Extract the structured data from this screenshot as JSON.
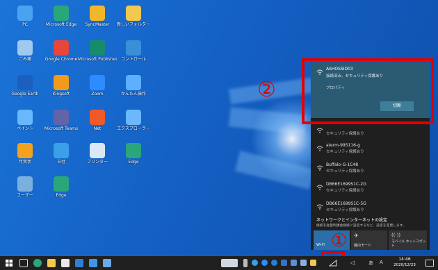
{
  "desktop_icons": [
    {
      "label": "PC",
      "icon": "pc-icon",
      "color": "#4aa3f0"
    },
    {
      "label": "Microsoft Edge",
      "icon": "edge-icon",
      "color": "#2aa77a"
    },
    {
      "label": "SyncMaster",
      "icon": "app-icon",
      "color": "#f1b72c"
    },
    {
      "label": "新しいフォルダー",
      "icon": "folder-icon",
      "color": "#f3c851"
    },
    {
      "label": "ごみ箱",
      "icon": "recycle-bin-icon",
      "color": "#9fc9ee"
    },
    {
      "label": "Google Chrome",
      "icon": "chrome-icon",
      "color": "#e9453a"
    },
    {
      "label": "Microsoft Publisher",
      "icon": "publisher-icon",
      "color": "#178c6a"
    },
    {
      "label": "コントロール",
      "icon": "control-panel-icon",
      "color": "#3a8fd8"
    },
    {
      "label": "Google Earth",
      "icon": "earth-icon",
      "color": "#1d5fbf"
    },
    {
      "label": "Kingsoft",
      "icon": "kingsoft-icon",
      "color": "#f39a1d"
    },
    {
      "label": "Zoom",
      "icon": "zoom-icon",
      "color": "#2d8cff"
    },
    {
      "label": "かんたん操作",
      "icon": "ease-icon",
      "color": "#5cb0ff"
    },
    {
      "label": "ペイント",
      "icon": "paint-icon",
      "color": "#68b7ff"
    },
    {
      "label": "Microsoft Teams",
      "icon": "teams-icon",
      "color": "#6264a7"
    },
    {
      "label": "Net",
      "icon": "net-icon",
      "color": "#f05a28"
    },
    {
      "label": "エクスプローラー",
      "icon": "explorer-icon",
      "color": "#6bb8ff"
    },
    {
      "label": "年賀状",
      "icon": "nenga-icon",
      "color": "#f4a21e"
    },
    {
      "label": "日付",
      "icon": "date-icon",
      "color": "#3aa0e8"
    },
    {
      "label": "プリンター",
      "icon": "printer-icon",
      "color": "#d9e8f5"
    },
    {
      "label": "Edge",
      "icon": "edge2-icon",
      "color": "#2aa77a"
    },
    {
      "label": "ユーザー",
      "icon": "user-icon",
      "color": "#7ab0e0"
    },
    {
      "label": "Edge",
      "icon": "edge3-icon",
      "color": "#2aa77a"
    }
  ],
  "wifi": {
    "selected": {
      "name": "ASHOSSID03",
      "status": "接続済み、セキュリティ保護あり",
      "properties": "プロパティ",
      "action": "切断"
    },
    "networks": [
      {
        "name": "",
        "security": "セキュリティ保護あり"
      },
      {
        "name": "aterm-995116-g",
        "security": "セキュリティ保護あり"
      },
      {
        "name": "Buffalo-G-1C48",
        "security": "セキュリティ保護あり"
      },
      {
        "name": "DB66E1699S1C-2G",
        "security": "セキュリティ保護あり"
      },
      {
        "name": "DB66E1699S1C-5G",
        "security": "セキュリティ保護あり"
      }
    ],
    "footer_title": "ネットワークとインターネットの設定",
    "footer_desc": "接続を従量制課金接続に設定するなど、設定を変更します。",
    "quick_tiles": [
      {
        "label": "Wi-Fi",
        "active": true
      },
      {
        "label": "機内モード",
        "active": false
      },
      {
        "label": "モバイル ホットスポット",
        "active": false
      }
    ]
  },
  "annotations": {
    "one": "①",
    "two": "②"
  },
  "clock": {
    "time": "14:46",
    "date": "2020/12/23"
  },
  "tray": {
    "ime": "A",
    "lang": "あ"
  },
  "colors": {
    "highlight": "#e30000",
    "accent": "#0078d7"
  }
}
